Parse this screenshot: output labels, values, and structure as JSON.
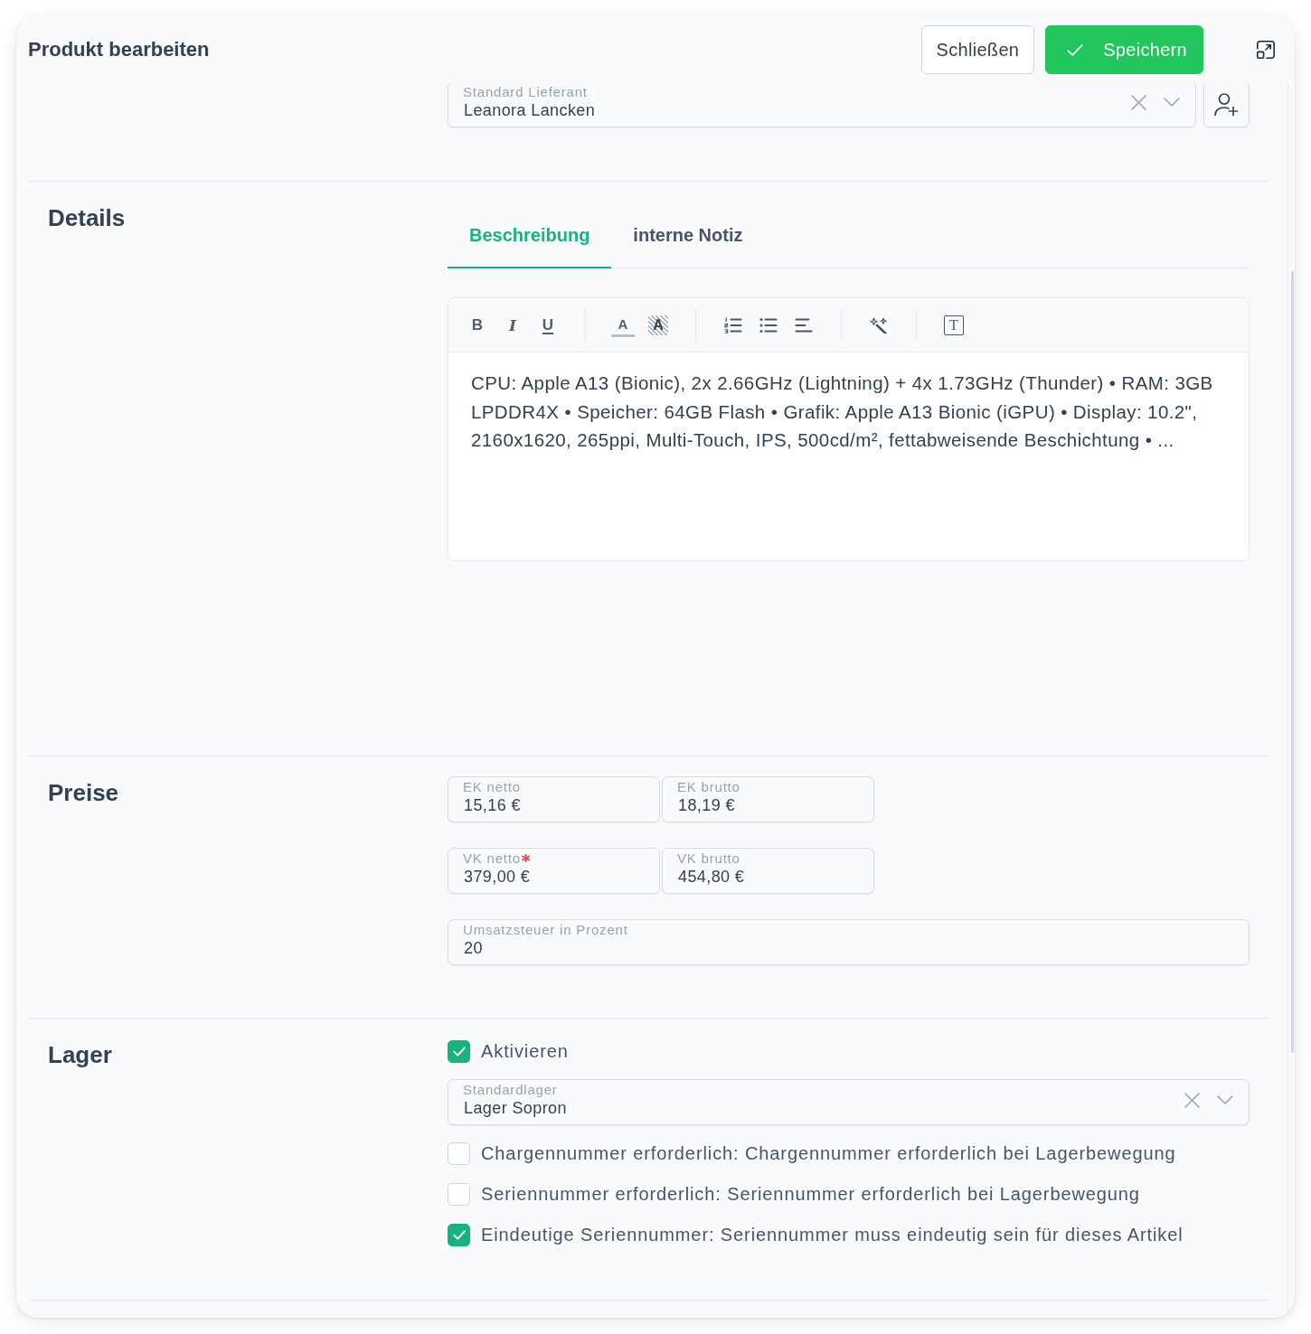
{
  "window": {
    "title": "Produkt bearbeiten"
  },
  "header_buttons": [
    {
      "kind": "secondary",
      "label": "Schließen"
    },
    {
      "kind": "primary",
      "label": "Speichern"
    }
  ],
  "supplier": {
    "label": "Standard Lieferant",
    "value": "Leanora Lancken"
  },
  "details": {
    "title": "Details",
    "tabs": [
      {
        "label": "Beschreibung",
        "selected": true
      },
      {
        "label": "interne Notiz",
        "selected": false
      }
    ],
    "toolbar": [
      {
        "kind": "bold",
        "glyph": "B"
      },
      {
        "kind": "italic",
        "glyph": "I"
      },
      {
        "kind": "underline",
        "glyph": "U"
      },
      {
        "kind": "separator"
      },
      {
        "kind": "text_color",
        "glyph": "A"
      },
      {
        "kind": "highlight",
        "glyph": "A"
      },
      {
        "kind": "separator"
      },
      {
        "kind": "ordered_list"
      },
      {
        "kind": "bullet_list"
      },
      {
        "kind": "align_left"
      },
      {
        "kind": "separator"
      },
      {
        "kind": "magic_wand"
      },
      {
        "kind": "separator"
      },
      {
        "kind": "text_box",
        "glyph": "T"
      }
    ],
    "content": "CPU: Apple A13 (Bionic), 2x 2.66GHz (Lightning) + 4x 1.73GHz (Thunder) • RAM: 3GB LPDDR4X • Speicher: 64GB Flash • Grafik: Apple A13 Bionic (iGPU) • Display: 10.2\", 2160x1620, 265ppi, Multi-Touch, IPS, 500cd/m², fettabweisende Beschichtung • ..."
  },
  "prices": {
    "title": "Preise",
    "rows": [
      [
        {
          "label": "EK netto",
          "required": false,
          "value": "15,16 €"
        },
        {
          "label": "EK brutto",
          "required": false,
          "value": "18,19 €"
        }
      ],
      [
        {
          "label": "VK netto",
          "required": true,
          "value": "379,00 €"
        },
        {
          "label": "VK brutto",
          "required": false,
          "value": "454,80 €"
        }
      ],
      [
        {
          "label": "Umsatzsteuer in Prozent",
          "required": false,
          "value": "20"
        }
      ]
    ]
  },
  "stock": {
    "title": "Lager",
    "items": [
      {
        "kind": "checkbox",
        "label": "Aktivieren",
        "checked": true
      },
      {
        "kind": "select",
        "label": "Standardlager",
        "value": "Lager Sopron"
      },
      {
        "kind": "checkbox",
        "label": "Chargennummer erforderlich: Chargennummer erforderlich bei Lagerbewegung",
        "checked": false
      },
      {
        "kind": "checkbox",
        "label": "Seriennummer erforderlich: Seriennummer erforderlich bei Lagerbewegung",
        "checked": false
      },
      {
        "kind": "checkbox",
        "label": "Eindeutige Seriennummer: Seriennummer muss eindeutig sein für dieses Artikel",
        "checked": true
      }
    ]
  }
}
